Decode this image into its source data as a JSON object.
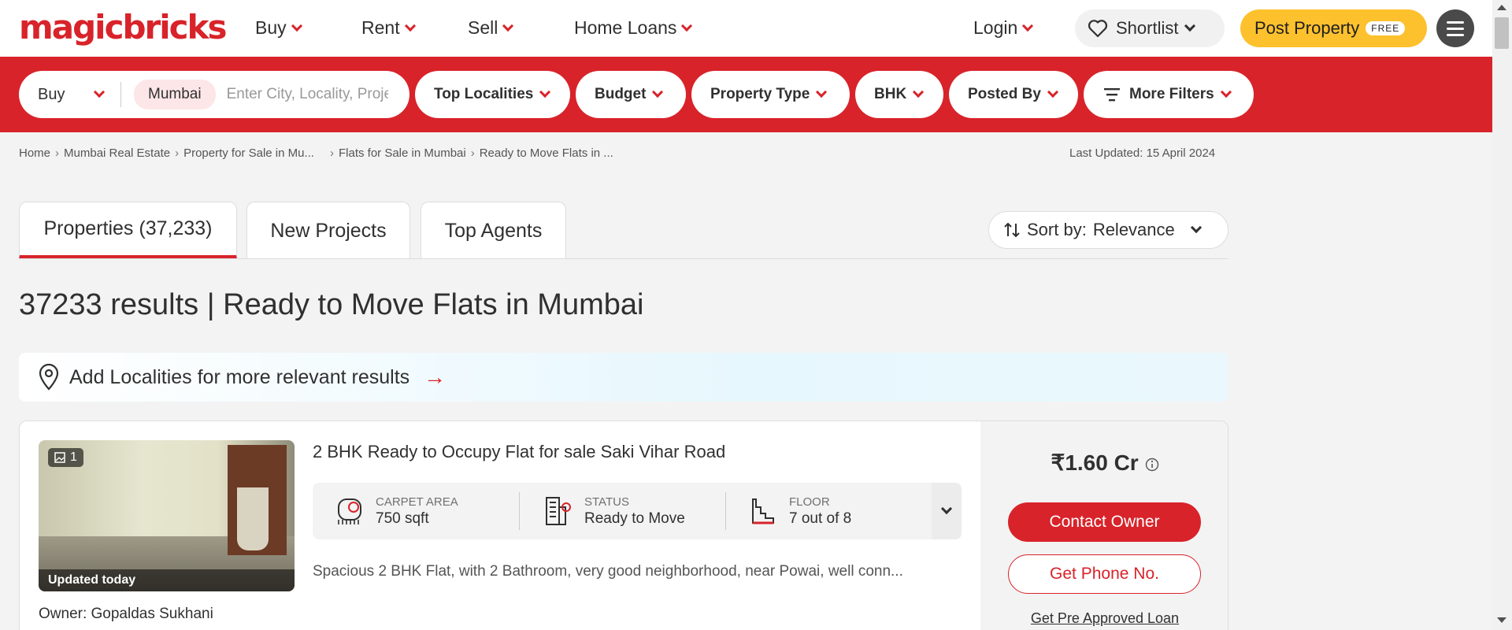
{
  "header": {
    "logo": "magicbricks",
    "nav": [
      "Buy",
      "Rent",
      "Sell",
      "Home Loans"
    ],
    "login": "Login",
    "shortlist": "Shortlist",
    "post_property": "Post Property",
    "free_tag": "FREE"
  },
  "filters": {
    "buy": "Buy",
    "city_chip": "Mumbai",
    "search_placeholder": "Enter City, Locality, Project",
    "pills": [
      "Top Localities",
      "Budget",
      "Property Type",
      "BHK",
      "Posted By",
      "More Filters"
    ]
  },
  "breadcrumb": {
    "items": [
      "Home",
      "Mumbai Real Estate",
      "Property for Sale in Mu...",
      "Flats for Sale in Mumbai",
      "Ready to Move Flats in ..."
    ],
    "last_updated": "Last Updated: 15 April 2024"
  },
  "tabs": [
    "Properties (37,233)",
    "New Projects",
    "Top Agents"
  ],
  "sort": {
    "label": "Sort by:",
    "value": "Relevance"
  },
  "page_title": "37233 results | Ready to Move Flats in Mumbai",
  "add_localities": "Add Localities for more relevant results",
  "listing": {
    "photo_count": "1",
    "photo_updated": "Updated today",
    "owner": "Owner: Gopaldas Sukhani",
    "title": "2 BHK Ready to Occupy Flat for sale Saki Vihar Road",
    "summary": [
      {
        "label": "CARPET AREA",
        "value": "750 sqft",
        "icon": "carpet-area-icon"
      },
      {
        "label": "STATUS",
        "value": "Ready to Move",
        "icon": "building-status-icon"
      },
      {
        "label": "FLOOR",
        "value": "7 out of 8",
        "icon": "stairs-icon"
      }
    ],
    "description": "Spacious 2 BHK Flat, with 2 Bathroom, very good neighborhood, near Powai, well conn...",
    "price": "₹1.60 Cr",
    "contact_owner": "Contact Owner",
    "get_phone": "Get Phone No.",
    "loan_link": "Get Pre Approved Loan"
  },
  "colors": {
    "brand_red": "#d8232a",
    "post_yellow": "#fdc12d"
  }
}
